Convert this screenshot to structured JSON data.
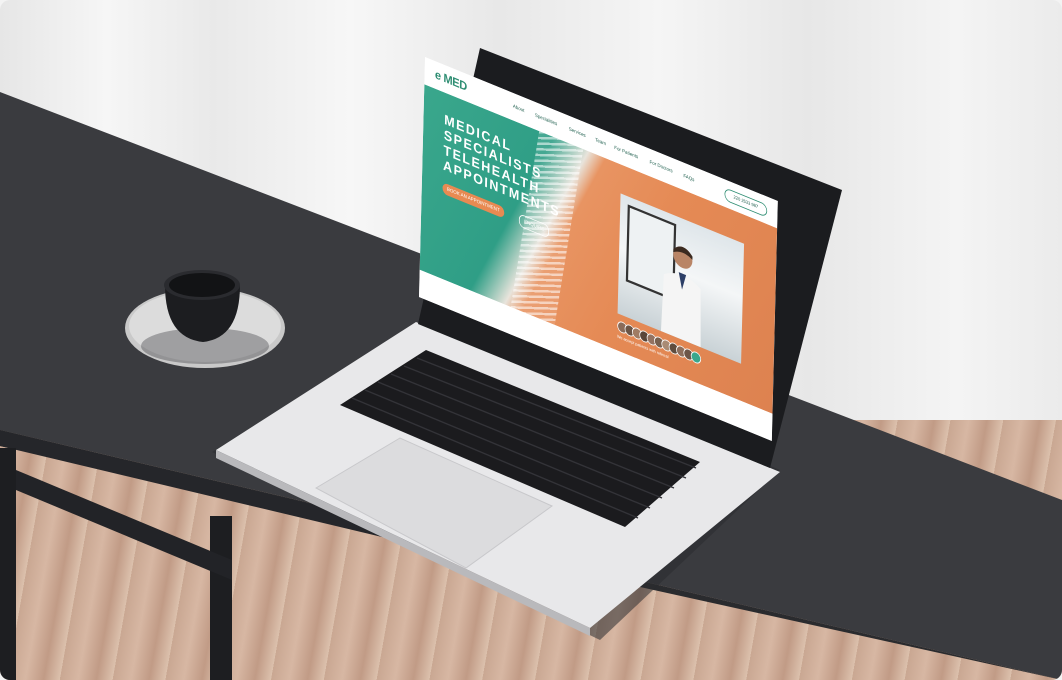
{
  "site": {
    "logo_text": "e MED",
    "nav_items": [
      "About",
      "Specialities",
      "Services",
      "Team",
      "For Patients",
      "For Doctors",
      "FAQs"
    ],
    "phone_button": "220 2533 987"
  },
  "hero": {
    "headline_lines": [
      "MEDICAL",
      "SPECIALISTS",
      "TELEHEALTH",
      "APPOINTMENTS"
    ],
    "primary_button": "BOOK AN APPOINTMENT",
    "secondary_button": "ENQUIRE",
    "avatars_note": "We accept patients with referral"
  },
  "colors": {
    "brand_green": "#2f8e73",
    "hero_orange": "#e58a55",
    "table_top": "#3b3c40"
  }
}
